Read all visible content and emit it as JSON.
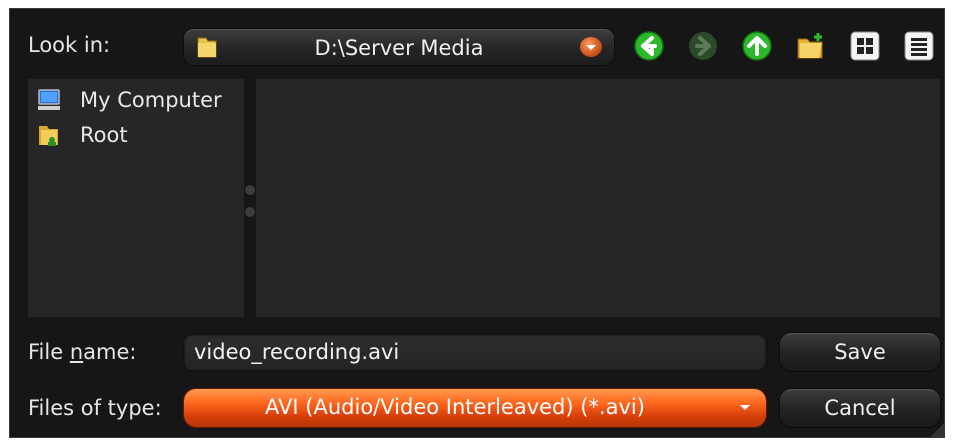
{
  "look_in": {
    "label": "Look in:",
    "path": "D:\\Server Media"
  },
  "toolbar": {
    "icons": [
      "back-icon",
      "forward-icon",
      "up-folder-icon",
      "new-folder-icon",
      "list-view-icon",
      "detail-view-icon"
    ]
  },
  "tree": {
    "items": [
      {
        "label": "My Computer",
        "icon": "computer-icon"
      },
      {
        "label": "Root",
        "icon": "folder-user-icon"
      }
    ]
  },
  "file_name": {
    "label_pre": "File ",
    "label_underline": "n",
    "label_post": "ame:",
    "value": "video_recording.avi"
  },
  "file_type": {
    "label": "Files of type:",
    "value": "AVI (Audio/Video Interleaved) (*.avi)"
  },
  "buttons": {
    "save": "Save",
    "cancel": "Cancel"
  },
  "colors": {
    "dialog_bg": "#161616",
    "pane_bg": "#262626",
    "accent": "#ff6a20",
    "nav_green": "#2fbf2f"
  }
}
